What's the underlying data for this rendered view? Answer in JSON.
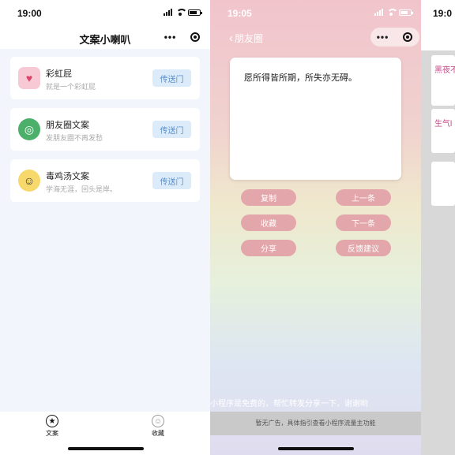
{
  "panel1": {
    "status_time": "19:00",
    "title": "文案小喇叭",
    "capsule": {
      "more_icon": "more-dots-icon",
      "close_icon": "target-icon"
    },
    "cards": [
      {
        "title": "彩虹屁",
        "subtitle": "就是一个彩虹屁",
        "button": "传送门",
        "icon": "heart-icon",
        "icon_bg": "#f7c9d4",
        "icon_glyph": "♥"
      },
      {
        "title": "朋友圈文案",
        "subtitle": "发朋友圈不再发愁",
        "button": "传送门",
        "icon": "shutter-icon",
        "icon_bg": "#4caf6a",
        "icon_glyph": "◎"
      },
      {
        "title": "毒鸡汤文案",
        "subtitle": "学海无涯，回头是岸。",
        "button": "传送门",
        "icon": "skull-face-icon",
        "icon_bg": "#f7d86a",
        "icon_glyph": "☺"
      }
    ],
    "tabs": [
      {
        "label": "文案",
        "icon": "star-icon",
        "active": true
      },
      {
        "label": "收藏",
        "icon": "user-icon",
        "active": false
      }
    ]
  },
  "panel2": {
    "status_time": "19:05",
    "back_label": "朋友圈",
    "quote": "愿所得皆所期，所失亦无碍。",
    "buttons_left": [
      "复制",
      "收藏",
      "分享"
    ],
    "buttons_right": [
      "上一条",
      "下一条",
      "反馈建议"
    ],
    "footer_scroll": "小程序是免费的，帮忙转发分享一下，谢谢哟",
    "ad_text": "暂无广告，具体指引查看小程序流量主功能"
  },
  "panel3": {
    "status_time": "19:0",
    "items": [
      "黑夜不",
      "生气l"
    ]
  },
  "colors": {
    "button_pink": "#e3a6aa",
    "card_button_bg": "#dcebfa",
    "card_button_text": "#5b8fc9",
    "panel3_text": "#c84a8a"
  }
}
